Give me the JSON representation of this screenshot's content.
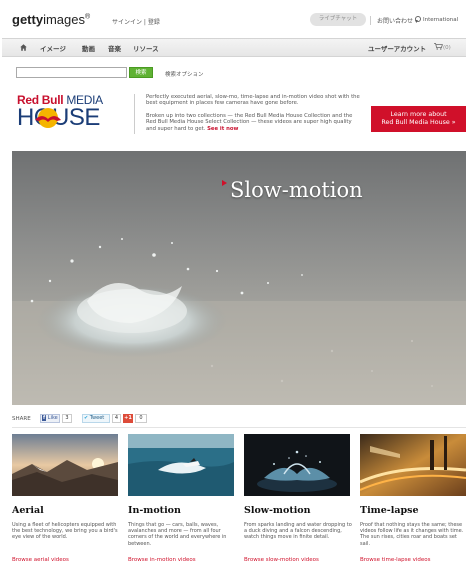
{
  "header": {
    "logo_bold": "getty",
    "logo_light": "images",
    "logo_mark": "®",
    "signin": "サインイン | 登録",
    "chat": "ライブチャット",
    "contact": "お問い合わせ ▾",
    "international": "International"
  },
  "nav": {
    "items": [
      "イメージ",
      "動画",
      "音楽",
      "リソース"
    ],
    "account": "ユーザーアカウント",
    "cart": "(0)"
  },
  "search": {
    "value": "",
    "button": "検索",
    "options": "検索オプション"
  },
  "banner": {
    "logo_line1_a": "Red Bull ",
    "logo_line1_b": "MEDIA",
    "logo_line2": "HOUSE",
    "text1": "Perfectly executed aerial, slow-mo, time-lapse and in-motion video shot with the best equipment in places few cameras have gone before.",
    "text2": "Broken up into two collections — the Red Bull Media House Collection and the Red Bull Media House Select Collection — these videos are super high quality and super hard to get.",
    "see_link": "See it now",
    "learn_button_line1": "Learn more about",
    "learn_button_line2": "Red Bull Media House »"
  },
  "hero": {
    "title": "Slow-motion"
  },
  "share": {
    "label": "SHARE",
    "fb_label": "Like",
    "fb_count": "3",
    "tw_label": "Tweet",
    "tw_count": "4",
    "gp_label": "+1",
    "gp_count": "0"
  },
  "cards": [
    {
      "title": "Aerial",
      "description": "Using a fleet of helicopters equipped with the best technology, we bring you a bird's eye view of the world.",
      "link": "Browse aerial videos"
    },
    {
      "title": "In-motion",
      "description": "Things that go — cars, balls, waves, avalanches and more — from all four corners of the world and everywhere in between.",
      "link": "Browse in-motion videos"
    },
    {
      "title": "Slow-motion",
      "description": "From sparks landing and water dropping to a duck diving and a falcon descending, watch things move in finite detail.",
      "link": "Browse slow-motion videos"
    },
    {
      "title": "Time-lapse",
      "description": "Proof that nothing stays the same; these videos follow life as it changes with time. The sun rises, cities roar and boats set sail.",
      "link": "Browse time-lapse videos"
    }
  ],
  "colors": {
    "brand_red": "#d0102a",
    "search_green": "#5fb233",
    "rb_blue": "#1b3d77"
  }
}
